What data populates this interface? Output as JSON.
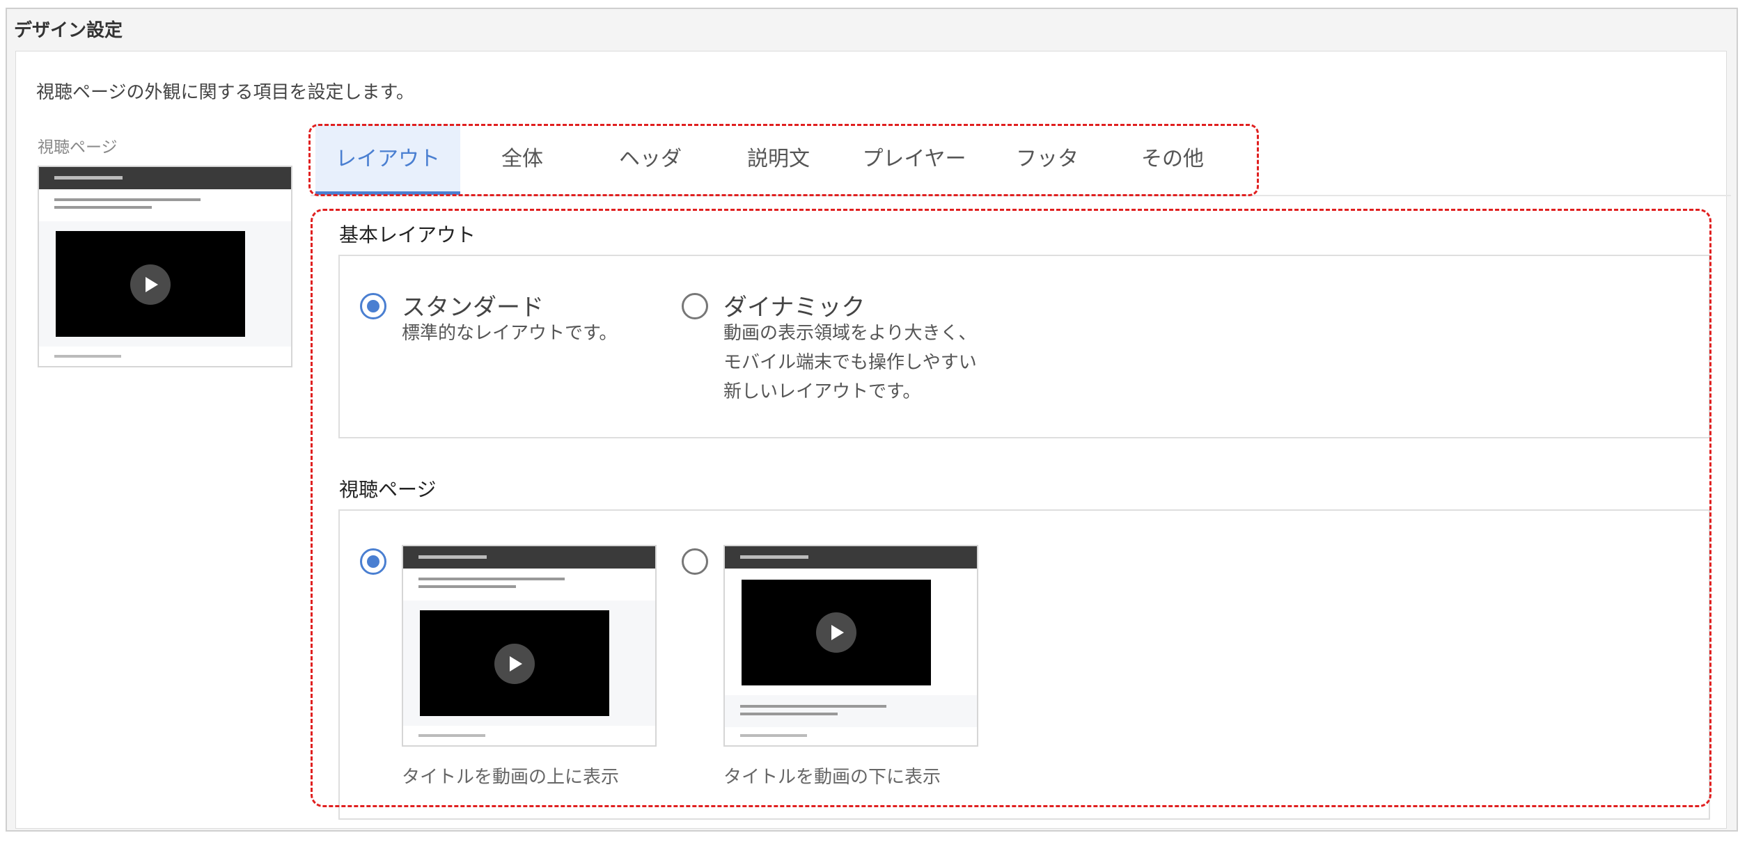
{
  "panel": {
    "title": "デザイン設定"
  },
  "description": "視聴ページの外観に関する項目を設定します。",
  "sidebar": {
    "preview_label": "視聴ページ"
  },
  "tabs": [
    {
      "label": "レイアウト",
      "active": true
    },
    {
      "label": "全体",
      "active": false
    },
    {
      "label": "ヘッダ",
      "active": false
    },
    {
      "label": "説明文",
      "active": false
    },
    {
      "label": "プレイヤー",
      "active": false
    },
    {
      "label": "フッタ",
      "active": false
    },
    {
      "label": "その他",
      "active": false
    }
  ],
  "basic_layout": {
    "title": "基本レイアウト",
    "options": [
      {
        "label": "スタンダード",
        "description": "標準的なレイアウトです。",
        "selected": true
      },
      {
        "label": "ダイナミック",
        "description": "動画の表示領域をより大きく、\nモバイル端末でも操作しやすい\n新しいレイアウトです。",
        "selected": false
      }
    ]
  },
  "viewing_page": {
    "title": "視聴ページ",
    "options": [
      {
        "caption": "タイトルを動画の上に表示",
        "selected": true
      },
      {
        "caption": "タイトルを動画の下に表示",
        "selected": false
      }
    ]
  },
  "colors": {
    "accent": "#4a7fd1",
    "highlight": "#e02020",
    "header_dark": "#3a3a3a"
  }
}
